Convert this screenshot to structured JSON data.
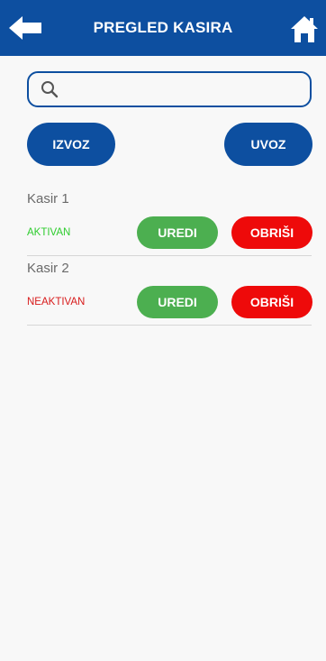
{
  "header": {
    "title": "PREGLED KASIRA",
    "back_icon": "arrow-left-icon",
    "home_icon": "home-icon",
    "color": "#0d4fa0"
  },
  "search": {
    "value": "",
    "placeholder": "",
    "icon": "search-icon"
  },
  "actions": {
    "export_label": "IZVOZ",
    "import_label": "UVOZ"
  },
  "cashiers": [
    {
      "name": "Kasir 1",
      "status": "AKTIVAN",
      "status_color": "#2ecc2e",
      "edit_label": "UREDI",
      "delete_label": "OBRIŠI"
    },
    {
      "name": "Kasir 2",
      "status": "NEAKTIVAN",
      "status_color": "#d81b1b",
      "edit_label": "UREDI",
      "delete_label": "OBRIŠI"
    }
  ],
  "colors": {
    "edit": "#4caf50",
    "delete": "#ee0a0a"
  }
}
